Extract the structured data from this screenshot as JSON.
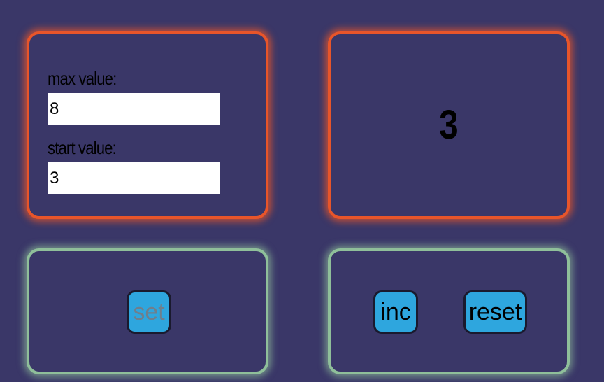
{
  "settings": {
    "max_label": "max value:",
    "max_value": "8",
    "start_label": "start value:",
    "start_value": "3"
  },
  "counter": {
    "value": "3"
  },
  "set_controls": {
    "set_label": "set",
    "set_disabled": true
  },
  "counter_controls": {
    "inc_label": "inc",
    "reset_label": "reset"
  },
  "colors": {
    "background": "#3a3768",
    "display_border": "#e8552a",
    "control_border": "#8fbf9a",
    "button": "#2ea6de"
  }
}
